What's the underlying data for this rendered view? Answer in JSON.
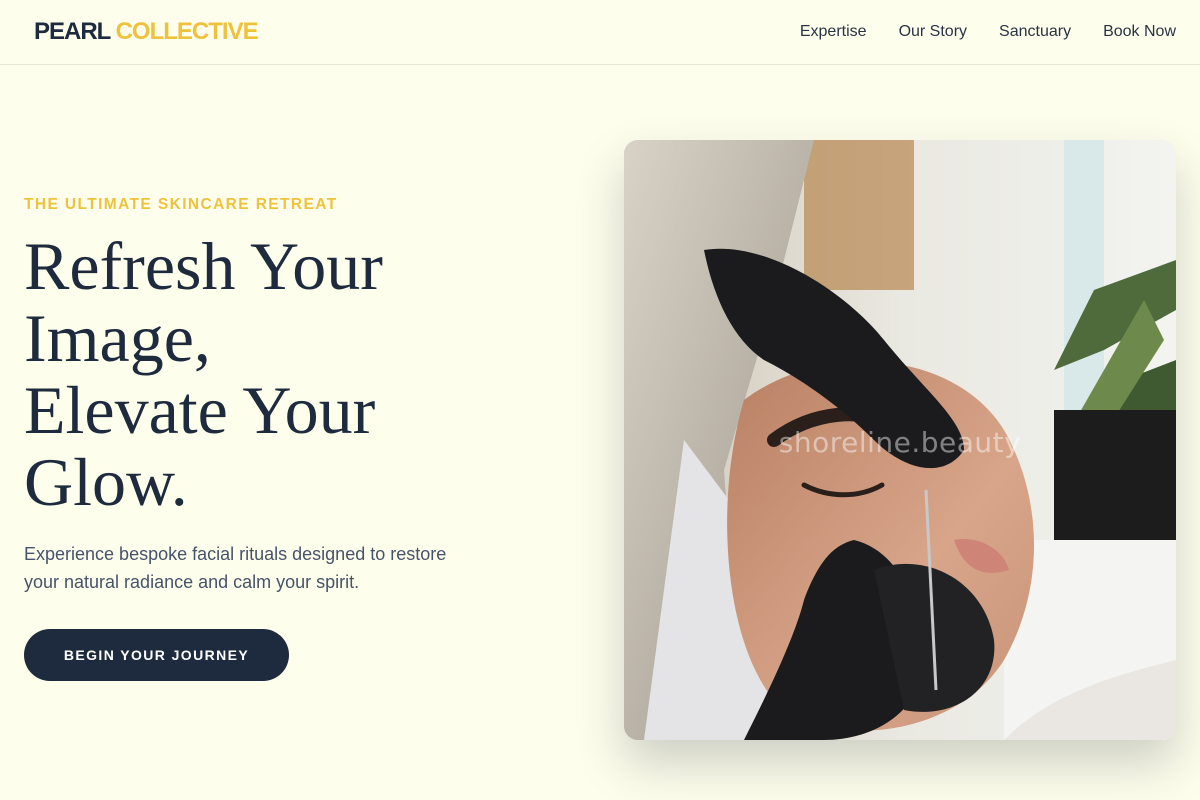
{
  "header": {
    "logo_primary": "PEARL",
    "logo_accent": "COLLECTIVE",
    "nav": [
      {
        "label": "Expertise"
      },
      {
        "label": "Our Story"
      },
      {
        "label": "Sanctuary"
      },
      {
        "label": "Book Now"
      }
    ]
  },
  "hero": {
    "eyebrow": "THE ULTIMATE SKINCARE RETREAT",
    "headline_lines": [
      "Refresh Your",
      "Image,",
      "Elevate Your",
      "Glow."
    ],
    "subtext": "Experience bespoke facial rituals designed to restore your natural radiance and calm your spirit.",
    "cta_label": "BEGIN YOUR JOURNEY"
  },
  "image": {
    "watermark": "shoreline.beauty",
    "subject": "skincare-extraction-treatment-photo"
  },
  "colors": {
    "background": "#fefeec",
    "navy": "#1e2a3d",
    "gold": "#eec23c",
    "body_text": "#47536a"
  }
}
